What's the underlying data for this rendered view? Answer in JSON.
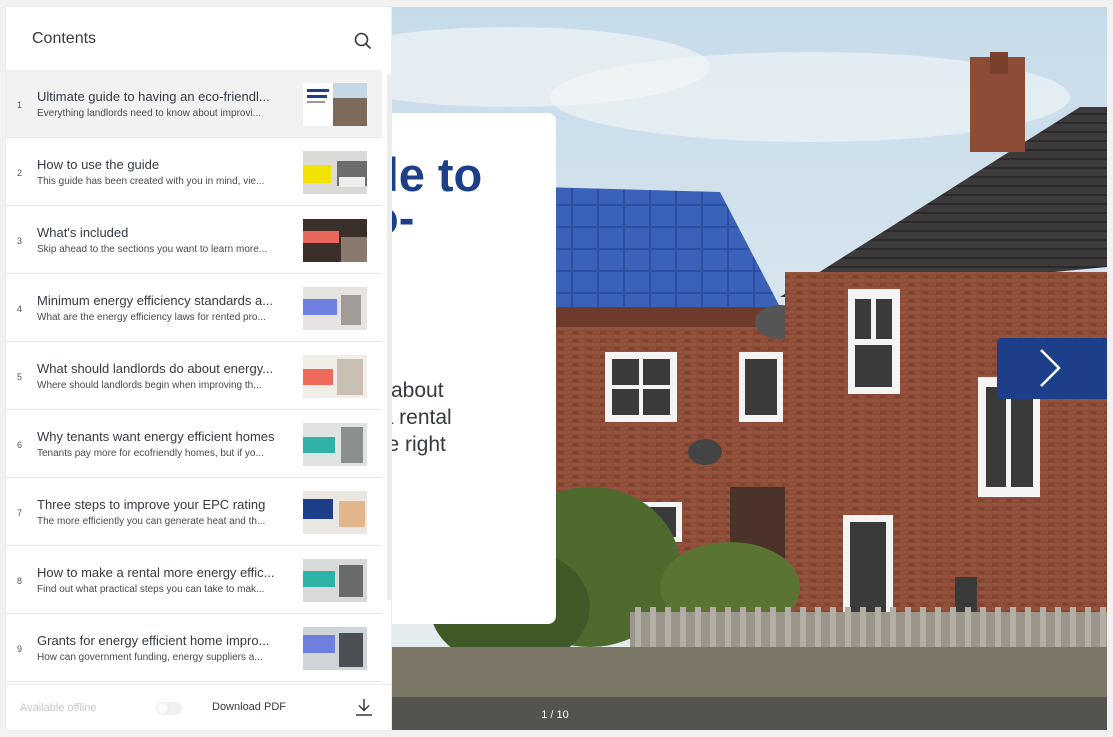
{
  "sidebar": {
    "title": "Contents",
    "items": [
      {
        "num": "1",
        "title": "Ultimate guide to having an eco-friendl...",
        "desc": "Everything landlords need to know about improvi...",
        "active": true
      },
      {
        "num": "2",
        "title": "How to use the guide",
        "desc": "This guide has been created with you in mind, vie...",
        "active": false
      },
      {
        "num": "3",
        "title": "What's included",
        "desc": "Skip ahead to the sections you want to learn more...",
        "active": false
      },
      {
        "num": "4",
        "title": "Minimum energy efficiency standards a...",
        "desc": "What are the energy efficiency laws for rented pro...",
        "active": false
      },
      {
        "num": "5",
        "title": "What should landlords do about energy...",
        "desc": "Where should landlords begin when improving th...",
        "active": false
      },
      {
        "num": "6",
        "title": "Why tenants want energy efficient homes",
        "desc": "Tenants pay more for ecofriendly homes, but if yo...",
        "active": false
      },
      {
        "num": "7",
        "title": "Three steps to improve your EPC rating",
        "desc": "The more efficiently you can generate heat and th...",
        "active": false
      },
      {
        "num": "8",
        "title": "How to make a rental more energy effic...",
        "desc": "Find out what practical steps you can take to mak...",
        "active": false
      },
      {
        "num": "9",
        "title": "Grants for energy efficient home impro...",
        "desc": "How can government funding, energy suppliers a...",
        "active": false
      }
    ],
    "footer": {
      "offline_label": "Available offline",
      "download_label": "Download PDF"
    }
  },
  "slide": {
    "title": "de to\no-\nl",
    "subtitle_1": "w about",
    "subtitle_2": "f a rental",
    "subtitle_3": "the right",
    "page_indicator": "1 / 10"
  },
  "colors": {
    "brand": "#1d3f8a"
  },
  "icons": {
    "search": "search-icon",
    "next": "chevron-right-icon",
    "download": "download-icon"
  }
}
